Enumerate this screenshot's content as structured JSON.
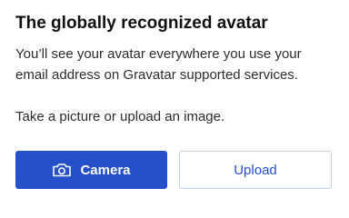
{
  "title": "The globally recognized avatar",
  "description": {
    "line1": "You’ll see your avatar everywhere you use your",
    "line2": "email address on Gravatar supported services.",
    "line3": "Take a picture or upload an image."
  },
  "actions": {
    "camera": {
      "label": "Camera",
      "icon": "camera-icon"
    },
    "upload": {
      "label": "Upload"
    }
  },
  "colors": {
    "primary": "#2650c9",
    "upload_border": "#c3cfe6",
    "text": "#2c2c2c"
  }
}
